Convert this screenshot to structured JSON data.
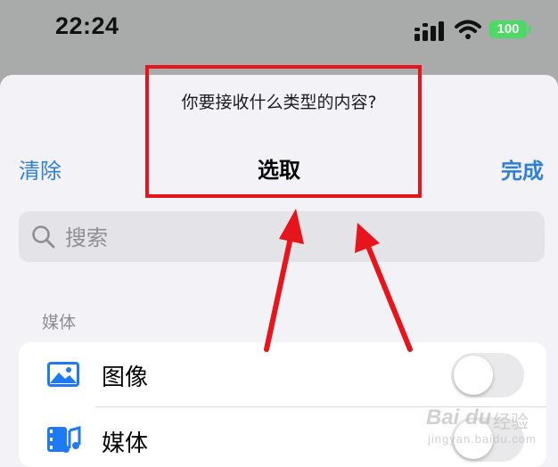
{
  "status_bar": {
    "time": "22:24",
    "battery": "100",
    "icons": [
      "signal-icon",
      "wifi-icon",
      "battery-icon"
    ]
  },
  "sheet": {
    "prompt": "你要接收什么类型的内容?",
    "title": "选取",
    "clear_label": "清除",
    "done_label": "完成"
  },
  "search": {
    "placeholder": "搜索",
    "icon": "search-icon"
  },
  "section": {
    "label": "媒体",
    "items": [
      {
        "label": "图像",
        "icon": "photo-icon",
        "enabled": false
      },
      {
        "label": "媒体",
        "icon": "media-icon",
        "enabled": false
      }
    ]
  },
  "colors": {
    "accent": "#2f7ed8",
    "highlight": "#e8141c",
    "battery": "#4cd964"
  },
  "watermark": {
    "logo": "Bai du",
    "brand": "经验",
    "site": "jingyan.baidu.com"
  }
}
